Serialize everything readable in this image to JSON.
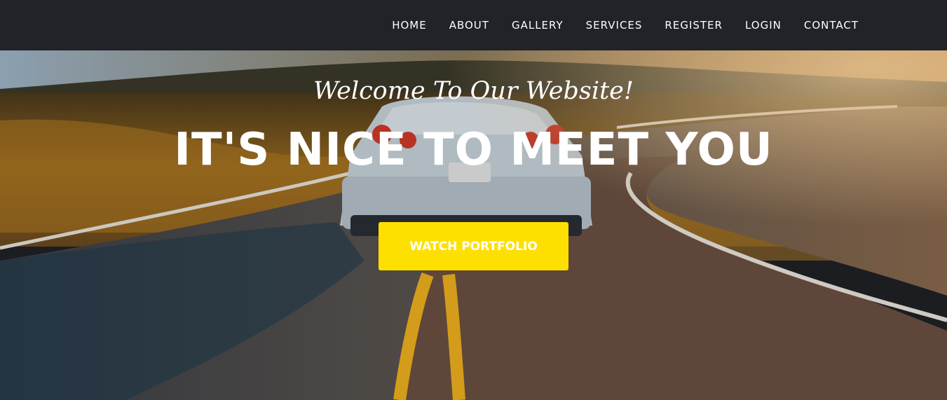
{
  "nav": {
    "items": [
      {
        "label": "HOME"
      },
      {
        "label": "ABOUT"
      },
      {
        "label": "GALLERY"
      },
      {
        "label": "SERVICES"
      },
      {
        "label": "REGISTER"
      },
      {
        "label": "LOGIN"
      },
      {
        "label": "CONTACT"
      }
    ]
  },
  "hero": {
    "subtitle": "Welcome To Our Website!",
    "title": "IT'S NICE TO MEET YOU",
    "cta_label": "WATCH PORTFOLIO"
  },
  "colors": {
    "navbar_bg": "#212329",
    "nav_text": "#ffffff",
    "cta_bg": "#fee000",
    "hero_text": "#ffffff"
  }
}
